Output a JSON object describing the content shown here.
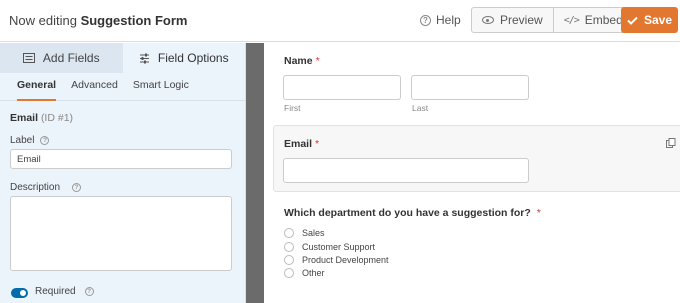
{
  "header": {
    "title_prefix": "Now editing",
    "form_name": "Suggestion Form",
    "help_label": "Help",
    "preview_label": "Preview",
    "embed_label": "Embed",
    "save_label": "Save",
    "accent_color": "#e27730"
  },
  "left_panel": {
    "tabs": [
      {
        "label": "Add Fields",
        "icon": "list-icon",
        "active": false
      },
      {
        "label": "Field Options",
        "icon": "sliders-icon",
        "active": true
      }
    ],
    "subtabs": [
      {
        "label": "General",
        "active": true
      },
      {
        "label": "Advanced",
        "active": false
      },
      {
        "label": "Smart Logic",
        "active": false
      }
    ],
    "field_name": "Email",
    "field_id": "(ID #1)",
    "label_caption": "Label",
    "label_value": "Email",
    "description_caption": "Description",
    "description_value": "",
    "required_label": "Required",
    "required_on": true
  },
  "preview": {
    "name_label": "Name",
    "first_label": "First",
    "last_label": "Last",
    "email_label": "Email",
    "required_mark": "*",
    "question": "Which department do you have a suggestion for?",
    "options": [
      "Sales",
      "Customer Support",
      "Product Development",
      "Other"
    ]
  }
}
